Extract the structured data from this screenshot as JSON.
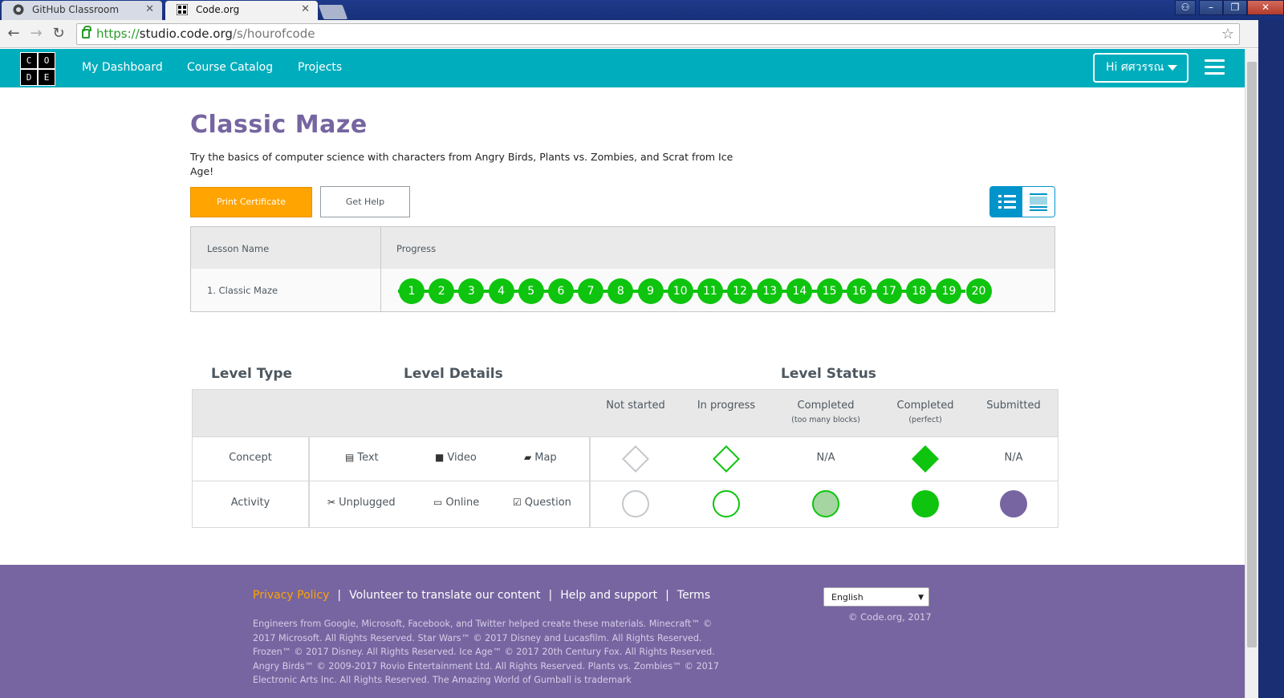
{
  "browser": {
    "tabs": [
      {
        "label": "GitHub Classroom",
        "active": false
      },
      {
        "label": "Code.org",
        "active": true
      }
    ],
    "url": {
      "scheme": "https://",
      "host": "studio.code.org",
      "path": "/s/hourofcode"
    },
    "icons": {
      "back": "back-arrow-icon",
      "forward": "forward-arrow-icon",
      "reload": "reload-icon",
      "bookmark": "star-icon"
    }
  },
  "header": {
    "logo_letters": [
      "C",
      "O",
      "D",
      "E"
    ],
    "nav": [
      "My Dashboard",
      "Course Catalog",
      "Projects"
    ],
    "user_label": "Hi ศศวรรณ",
    "brand_color": "#00adbc"
  },
  "main": {
    "title": "Classic Maze",
    "description": "Try the basics of computer science with characters from Angry Birds, Plants vs. Zombies, and Scrat from Ice Age!",
    "buttons": {
      "print_certificate": "Print Certificate",
      "get_help": "Get Help"
    },
    "progress_table": {
      "headers": [
        "Lesson Name",
        "Progress"
      ],
      "rows": [
        {
          "lesson": "1. Classic Maze",
          "levels": [
            "1",
            "2",
            "3",
            "4",
            "5",
            "6",
            "7",
            "8",
            "9",
            "10",
            "11",
            "12",
            "13",
            "14",
            "15",
            "16",
            "17",
            "18",
            "19",
            "20"
          ],
          "status": "completed-perfect"
        }
      ]
    }
  },
  "legend": {
    "headings": {
      "type": "Level Type",
      "details": "Level Details",
      "status": "Level Status"
    },
    "status_columns": [
      {
        "label": "Not started",
        "sub": ""
      },
      {
        "label": "In progress",
        "sub": ""
      },
      {
        "label": "Completed",
        "sub": "(too many blocks)"
      },
      {
        "label": "Completed",
        "sub": "(perfect)"
      },
      {
        "label": "Submitted",
        "sub": ""
      }
    ],
    "rows": [
      {
        "type": "Concept",
        "details": [
          {
            "icon": "document-icon",
            "label": "Text"
          },
          {
            "icon": "video-camera-icon",
            "label": "Video"
          },
          {
            "icon": "map-icon",
            "label": "Map"
          }
        ],
        "na": "N/A"
      },
      {
        "type": "Activity",
        "details": [
          {
            "icon": "scissors-icon",
            "label": "Unplugged"
          },
          {
            "icon": "desktop-icon",
            "label": "Online"
          },
          {
            "icon": "checkbox-icon",
            "label": "Question"
          }
        ]
      }
    ],
    "colors": {
      "green": "#0ec40e",
      "light_green": "#a5d6a1",
      "purple": "#7665a0",
      "grey": "#c5c8cb"
    }
  },
  "footer": {
    "links": [
      "Privacy Policy",
      "Volunteer to translate our content",
      "Help and support",
      "Terms"
    ],
    "fine_print": "Engineers from Google, Microsoft, Facebook, and Twitter helped create these materials. Minecraft™ © 2017 Microsoft. All Rights Reserved. Star Wars™ © 2017 Disney and Lucasfilm. All Rights Reserved. Frozen™ © 2017 Disney. All Rights Reserved. Ice Age™ © 2017 20th Century Fox. All Rights Reserved. Angry Birds™ © 2009-2017 Rovio Entertainment Ltd. All Rights Reserved. Plants vs. Zombies™ © 2017 Electronic Arts Inc. All Rights Reserved. The Amazing World of Gumball is trademark",
    "language": "English",
    "copyright": "© Code.org, 2017",
    "background": "#7665a0"
  }
}
